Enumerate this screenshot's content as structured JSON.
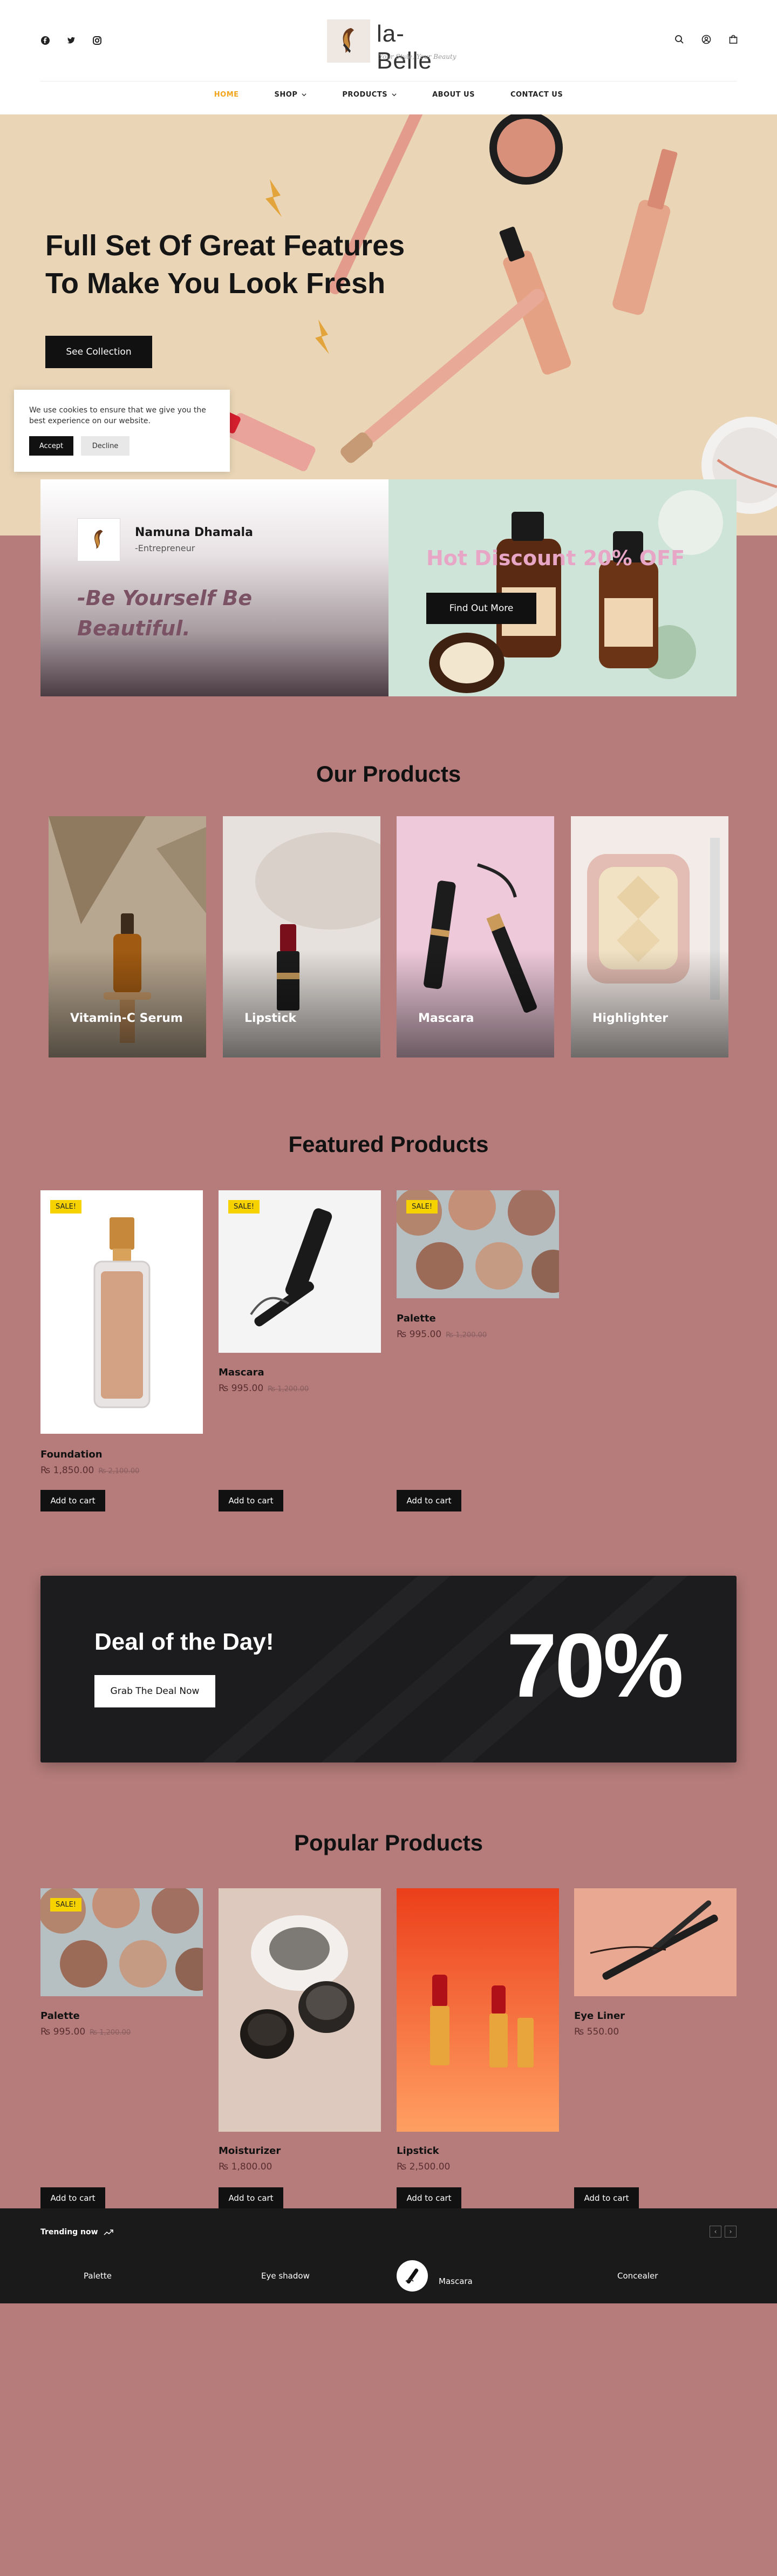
{
  "header": {
    "brand": "la-Belle",
    "tagline": "Your Style, Your Beauty",
    "nav": [
      {
        "label": "HOME",
        "dropdown": false
      },
      {
        "label": "SHOP",
        "dropdown": true
      },
      {
        "label": "PRODUCTS",
        "dropdown": true
      },
      {
        "label": "ABOUT US",
        "dropdown": false
      },
      {
        "label": "CONTACT US",
        "dropdown": false
      }
    ],
    "social_icons": [
      "facebook-icon",
      "twitter-icon",
      "instagram-icon"
    ],
    "action_icons": [
      "search-icon",
      "account-icon",
      "cart-icon"
    ]
  },
  "hero": {
    "title_line1": "Full Set Of Great Features",
    "title_line2": "To Make You Look Fresh",
    "button": "See Collection"
  },
  "cookie": {
    "text": "We use cookies to ensure that we give you the best experience on our website.",
    "accept": "Accept",
    "decline": "Decline"
  },
  "promo": {
    "author_name": "Namuna Dhamala",
    "author_role": "-Entrepreneur",
    "quote": "-Be Yourself Be Beautiful.",
    "discount": "Hot Discount 20% OFF",
    "discount_button": "Find Out More"
  },
  "our_products": {
    "title": "Our Products",
    "categories": [
      "Vitamin-C Serum",
      "Lipstick",
      "Mascara",
      "Highlighter"
    ]
  },
  "featured": {
    "title": "Featured Products",
    "sale_label": "SALE!",
    "cart_label": "Add to cart",
    "items": [
      {
        "name": "Foundation",
        "price": "₨ 1,850.00",
        "old_price": "₨ 2,100.00"
      },
      {
        "name": "Mascara",
        "price": "₨ 995.00",
        "old_price": "₨ 1,200.00"
      },
      {
        "name": "Palette",
        "price": "₨ 995.00",
        "old_price": "₨ 1,200.00"
      }
    ]
  },
  "deal": {
    "title": "Deal of the Day!",
    "button": "Grab The Deal Now",
    "percent": "70%"
  },
  "popular": {
    "title": "Popular Products",
    "sale_label": "SALE!",
    "cart_label": "Add to cart",
    "items": [
      {
        "name": "Palette",
        "price": "₨ 995.00",
        "old_price": "₨ 1,200.00"
      },
      {
        "name": "Moisturizer",
        "price": "₨ 1,800.00",
        "old_price": ""
      },
      {
        "name": "Lipstick",
        "price": "₨ 2,500.00",
        "old_price": ""
      },
      {
        "name": "Eye Liner",
        "price": "₨ 550.00",
        "old_price": ""
      }
    ]
  },
  "trending": {
    "title": "Trending now",
    "items": [
      "Palette",
      "Eye shadow",
      "Mascara",
      "Concealer"
    ]
  },
  "colors": {
    "accent": "#f2a51a",
    "page_background": "#b57c7b",
    "sale_badge": "#f6d200",
    "dark": "#111111"
  }
}
